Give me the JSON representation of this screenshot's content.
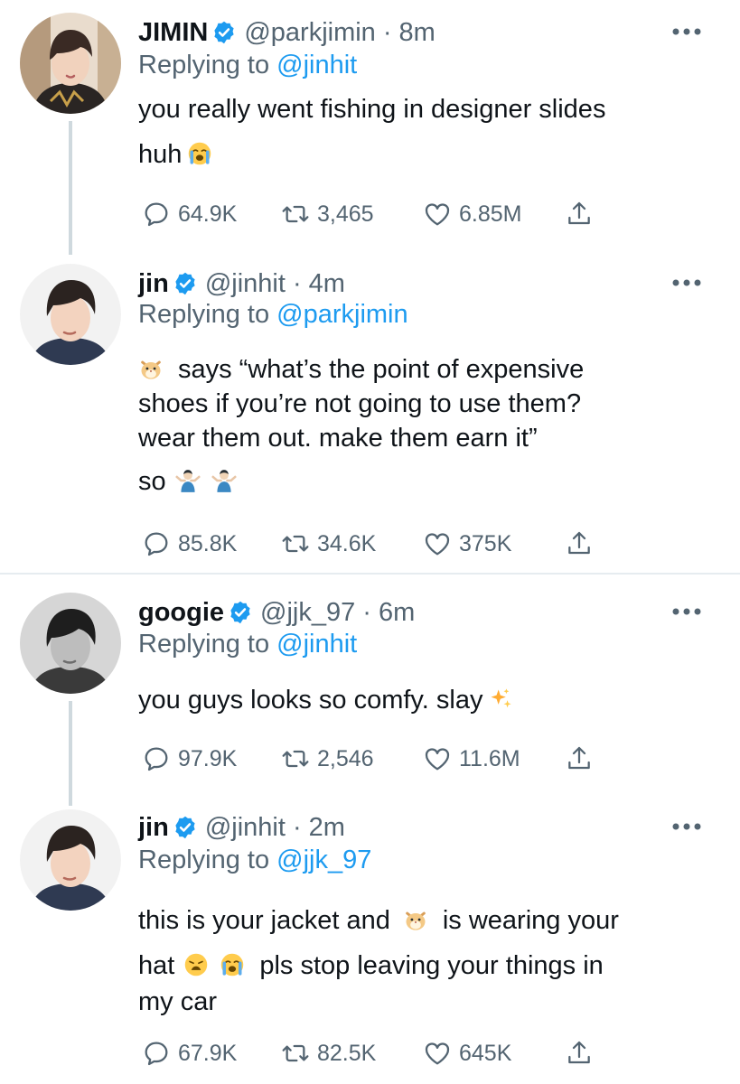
{
  "tweets": [
    {
      "name": "JIMIN",
      "handle": "@parkjimin",
      "separator": "·",
      "time": "8m",
      "reply_prefix": "Replying to ",
      "reply_to": "@jinhit",
      "body_line1": "you really went fishing in designer slides",
      "body_line2": "huh",
      "replies": "64.9K",
      "retweets": "3,465",
      "likes": "6.85M",
      "emoji": [
        "loudly-crying-face"
      ]
    },
    {
      "name": "jin",
      "handle": "@jinhit",
      "separator": "·",
      "time": "4m",
      "reply_prefix": "Replying to ",
      "reply_to": "@parkjimin",
      "body_line1": "says “what’s the point of expensive",
      "body_line2": "shoes if you’re not going to use them?",
      "body_line3": "wear them out. make them earn it”",
      "body_line4": "so",
      "replies": "85.8K",
      "retweets": "34.6K",
      "likes": "375K",
      "emoji": [
        "hamster-face",
        "person-shrugging",
        "person-shrugging"
      ]
    },
    {
      "name": "googie",
      "handle": "@jjk_97",
      "separator": "·",
      "time": "6m",
      "reply_prefix": "Replying to ",
      "reply_to": "@jinhit",
      "body_line1": "you guys looks so comfy. slay",
      "replies": "97.9K",
      "retweets": "2,546",
      "likes": "11.6M",
      "emoji": [
        "sparkles"
      ]
    },
    {
      "name": "jin",
      "handle": "@jinhit",
      "separator": "·",
      "time": "2m",
      "reply_prefix": "Replying to ",
      "reply_to": "@jjk_97",
      "body_line1a": "this is your jacket and",
      "body_line1b": "is wearing your",
      "body_line2a": "hat",
      "body_line2b": "pls stop leaving your things in",
      "body_line3": "my car",
      "replies": "67.9K",
      "retweets": "82.5K",
      "likes": "645K",
      "emoji": [
        "hamster-face",
        "weary-face",
        "loudly-crying-face"
      ]
    }
  ],
  "colors": {
    "text": "#0f1419",
    "secondary": "#536471",
    "accent": "#1d9bf0",
    "thread_line": "#cfd9de",
    "divider": "#e6ecf0"
  },
  "icons": [
    "reply-icon",
    "retweet-icon",
    "like-icon",
    "share-icon",
    "more-icon",
    "verified-icon"
  ]
}
